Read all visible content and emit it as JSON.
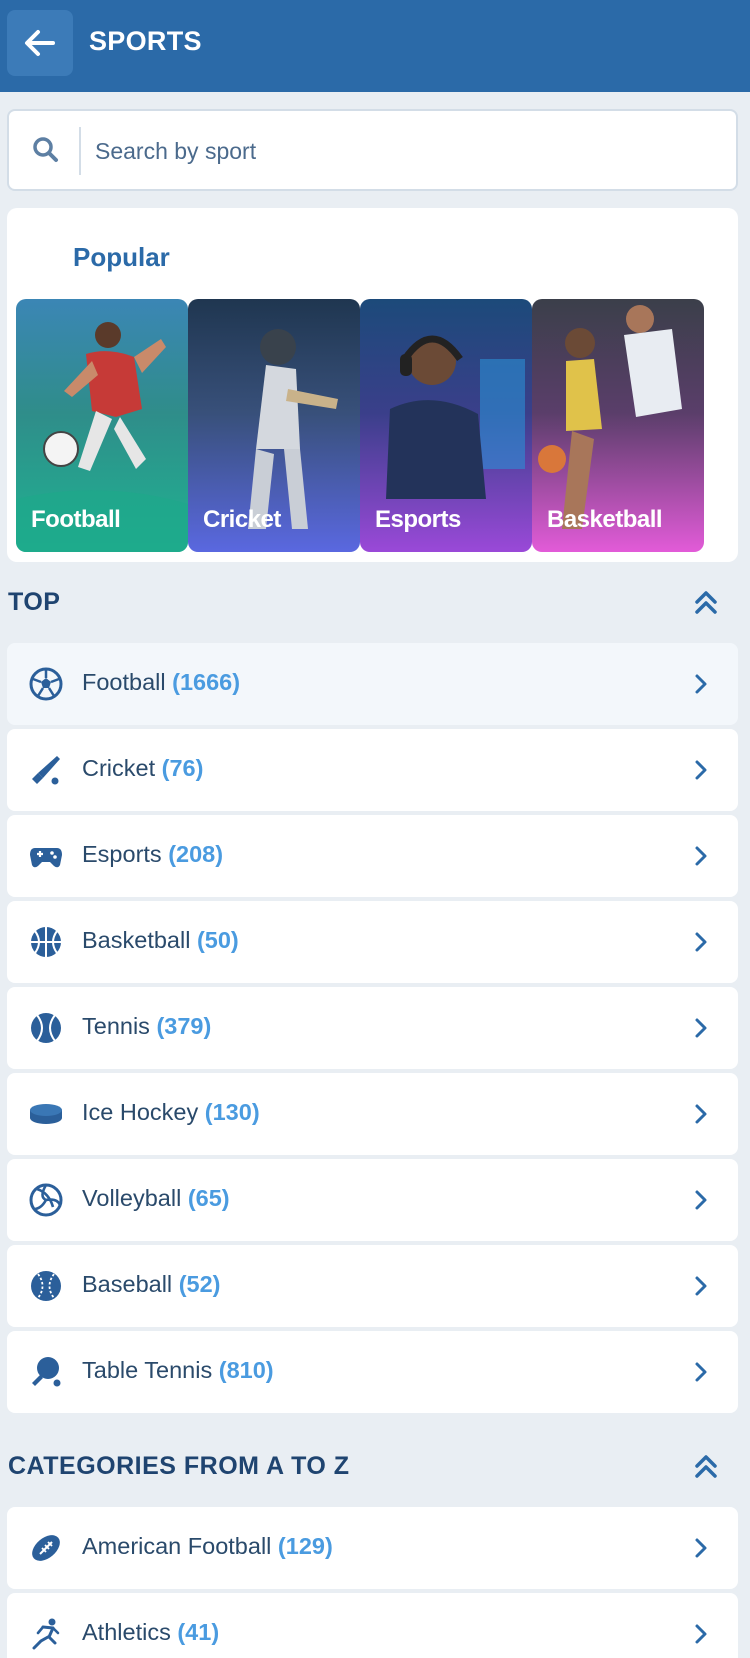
{
  "header": {
    "title": "SPORTS",
    "back_icon": "arrow-left-icon"
  },
  "search": {
    "placeholder": "Search by sport"
  },
  "popular": {
    "title": "Popular",
    "tiles": [
      {
        "label": "Football"
      },
      {
        "label": "Cricket"
      },
      {
        "label": "Esports"
      },
      {
        "label": "Basketball"
      }
    ]
  },
  "top": {
    "title": "TOP",
    "items": [
      {
        "name": "Football",
        "count": "(1666)",
        "icon": "football-icon"
      },
      {
        "name": "Cricket",
        "count": "(76)",
        "icon": "cricket-bat-icon"
      },
      {
        "name": "Esports",
        "count": "(208)",
        "icon": "gamepad-icon"
      },
      {
        "name": "Basketball",
        "count": "(50)",
        "icon": "basketball-icon"
      },
      {
        "name": "Tennis",
        "count": "(379)",
        "icon": "tennis-ball-icon"
      },
      {
        "name": "Ice Hockey",
        "count": "(130)",
        "icon": "hockey-puck-icon"
      },
      {
        "name": "Volleyball",
        "count": "(65)",
        "icon": "volleyball-icon"
      },
      {
        "name": "Baseball",
        "count": "(52)",
        "icon": "baseball-icon"
      },
      {
        "name": "Table Tennis",
        "count": "(810)",
        "icon": "table-tennis-icon"
      }
    ]
  },
  "categories": {
    "title": "CATEGORIES FROM A TO Z",
    "items": [
      {
        "name": "American Football",
        "count": "(129)",
        "icon": "american-football-icon"
      },
      {
        "name": "Athletics",
        "count": "(41)",
        "icon": "runner-icon"
      }
    ]
  },
  "colors": {
    "header": "#2b6aa8",
    "count": "#4a9be0",
    "icon": "#2b5f9a",
    "background": "#e9eef3"
  }
}
